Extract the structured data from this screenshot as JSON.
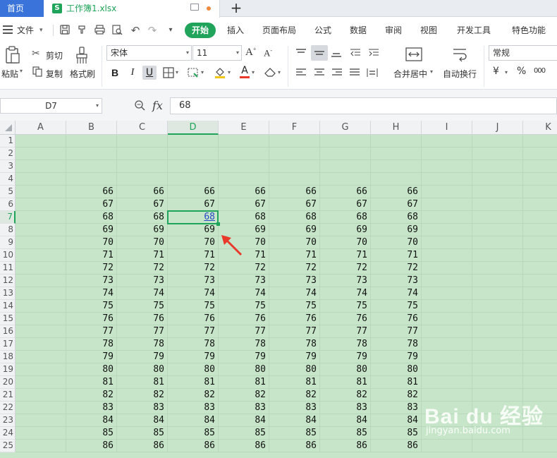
{
  "tabs": {
    "home": "首页",
    "file": "工作簿1.xlsx",
    "file_icon": "S",
    "add": "+"
  },
  "menu": {
    "file": "文件",
    "items": [
      "开始",
      "插入",
      "页面布局",
      "公式",
      "数据",
      "审阅",
      "视图",
      "开发工具",
      "特色功能"
    ]
  },
  "ribbon": {
    "paste": "粘贴",
    "cut": "剪切",
    "copy": "复制",
    "format_painter": "格式刷",
    "font_name": "宋体",
    "font_size": "11",
    "merge_center": "合并居中",
    "wrap_text": "自动换行",
    "number_format": "常规",
    "currency": "¥",
    "percent": "%",
    "thousands": "000"
  },
  "formula_bar": {
    "name_box": "D7",
    "fx": "fx",
    "value": "68"
  },
  "sheet": {
    "columns": [
      "A",
      "B",
      "C",
      "D",
      "E",
      "F",
      "G",
      "H",
      "I",
      "J",
      "K"
    ],
    "selected_column": "D",
    "selected_row": 7,
    "rows": [
      {
        "n": "1",
        "v": []
      },
      {
        "n": "2",
        "v": []
      },
      {
        "n": "3",
        "v": []
      },
      {
        "n": "4",
        "v": []
      },
      {
        "n": "5",
        "v": [
          "66",
          "66",
          "66",
          "66",
          "66",
          "66",
          "66"
        ]
      },
      {
        "n": "6",
        "v": [
          "67",
          "67",
          "67",
          "67",
          "67",
          "67",
          "67"
        ]
      },
      {
        "n": "7",
        "v": [
          "68",
          "68",
          "68",
          "68",
          "68",
          "68",
          "68"
        ]
      },
      {
        "n": "8",
        "v": [
          "69",
          "69",
          "69",
          "69",
          "69",
          "69",
          "69"
        ]
      },
      {
        "n": "9",
        "v": [
          "70",
          "70",
          "70",
          "70",
          "70",
          "70",
          "70"
        ]
      },
      {
        "n": "10",
        "v": [
          "71",
          "71",
          "71",
          "71",
          "71",
          "71",
          "71"
        ]
      },
      {
        "n": "11",
        "v": [
          "72",
          "72",
          "72",
          "72",
          "72",
          "72",
          "72"
        ]
      },
      {
        "n": "12",
        "v": [
          "73",
          "73",
          "73",
          "73",
          "73",
          "73",
          "73"
        ]
      },
      {
        "n": "13",
        "v": [
          "74",
          "74",
          "74",
          "74",
          "74",
          "74",
          "74"
        ]
      },
      {
        "n": "14",
        "v": [
          "75",
          "75",
          "75",
          "75",
          "75",
          "75",
          "75"
        ]
      },
      {
        "n": "15",
        "v": [
          "76",
          "76",
          "76",
          "76",
          "76",
          "76",
          "76"
        ]
      },
      {
        "n": "16",
        "v": [
          "77",
          "77",
          "77",
          "77",
          "77",
          "77",
          "77"
        ]
      },
      {
        "n": "17",
        "v": [
          "78",
          "78",
          "78",
          "78",
          "78",
          "78",
          "78"
        ]
      },
      {
        "n": "18",
        "v": [
          "79",
          "79",
          "79",
          "79",
          "79",
          "79",
          "79"
        ]
      },
      {
        "n": "19",
        "v": [
          "80",
          "80",
          "80",
          "80",
          "80",
          "80",
          "80"
        ]
      },
      {
        "n": "20",
        "v": [
          "81",
          "81",
          "81",
          "81",
          "81",
          "81",
          "81"
        ]
      },
      {
        "n": "21",
        "v": [
          "82",
          "82",
          "82",
          "82",
          "82",
          "82",
          "82"
        ]
      },
      {
        "n": "22",
        "v": [
          "83",
          "83",
          "83",
          "83",
          "83",
          "83",
          "83"
        ]
      },
      {
        "n": "23",
        "v": [
          "84",
          "84",
          "84",
          "84",
          "84",
          "84",
          "84"
        ]
      },
      {
        "n": "24",
        "v": [
          "85",
          "85",
          "85",
          "85",
          "85",
          "85",
          "85"
        ]
      },
      {
        "n": "25",
        "v": [
          "86",
          "86",
          "86",
          "86",
          "86",
          "86",
          "86"
        ]
      }
    ]
  },
  "watermark": {
    "brand": "Bai du 经验",
    "url": "jingyan.baidu.com"
  },
  "colors": {
    "accent_green": "#20a35b",
    "home_tab_blue": "#3a73d9",
    "sheet_bg": "#c7e6c9",
    "arrow_red": "#e8392a"
  }
}
